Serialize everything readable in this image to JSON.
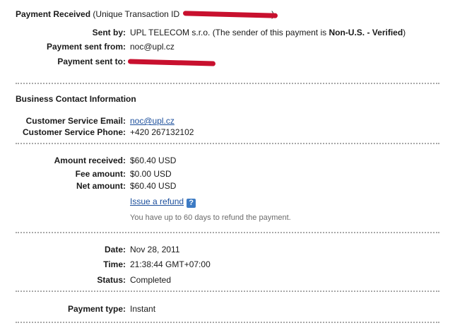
{
  "header": {
    "title": "Payment Received",
    "transaction_prefix": "(Unique Transaction ID",
    "transaction_suffix": ")"
  },
  "sender": {
    "sent_by_label": "Sent by:",
    "sent_by_name": "UPL TELECOM s.r.o.",
    "sent_by_note_prefix": "(The sender of this payment is",
    "sent_by_status": "Non-U.S. - Verified",
    "sent_by_note_suffix": ")",
    "sent_from_label": "Payment sent from:",
    "sent_from_value": "noc@upl.cz",
    "sent_to_label": "Payment sent to:"
  },
  "business": {
    "section_title": "Business Contact Information",
    "email_label": "Customer Service Email:",
    "email_value": "noc@upl.cz",
    "phone_label": "Customer Service Phone:",
    "phone_value": "+420 267132102"
  },
  "amounts": {
    "received_label": "Amount received:",
    "received_value": "$60.40 USD",
    "fee_label": "Fee amount:",
    "fee_value": "$0.00 USD",
    "net_label": "Net amount:",
    "net_value": "$60.40 USD",
    "refund_link": "Issue a refund",
    "help_icon_glyph": "?",
    "refund_note": "You have up to 60 days to refund the payment."
  },
  "details": {
    "date_label": "Date:",
    "date_value": "Nov 28, 2011",
    "time_label": "Time:",
    "time_value": "21:38:44 GMT+07:00",
    "status_label": "Status:",
    "status_value": "Completed"
  },
  "payment_type": {
    "label": "Payment type:",
    "value": "Instant"
  },
  "colors": {
    "link": "#1c4f9c",
    "redaction": "#c8102e",
    "help_icon": "#3d7bc4",
    "separator": "#a8a8a8"
  }
}
